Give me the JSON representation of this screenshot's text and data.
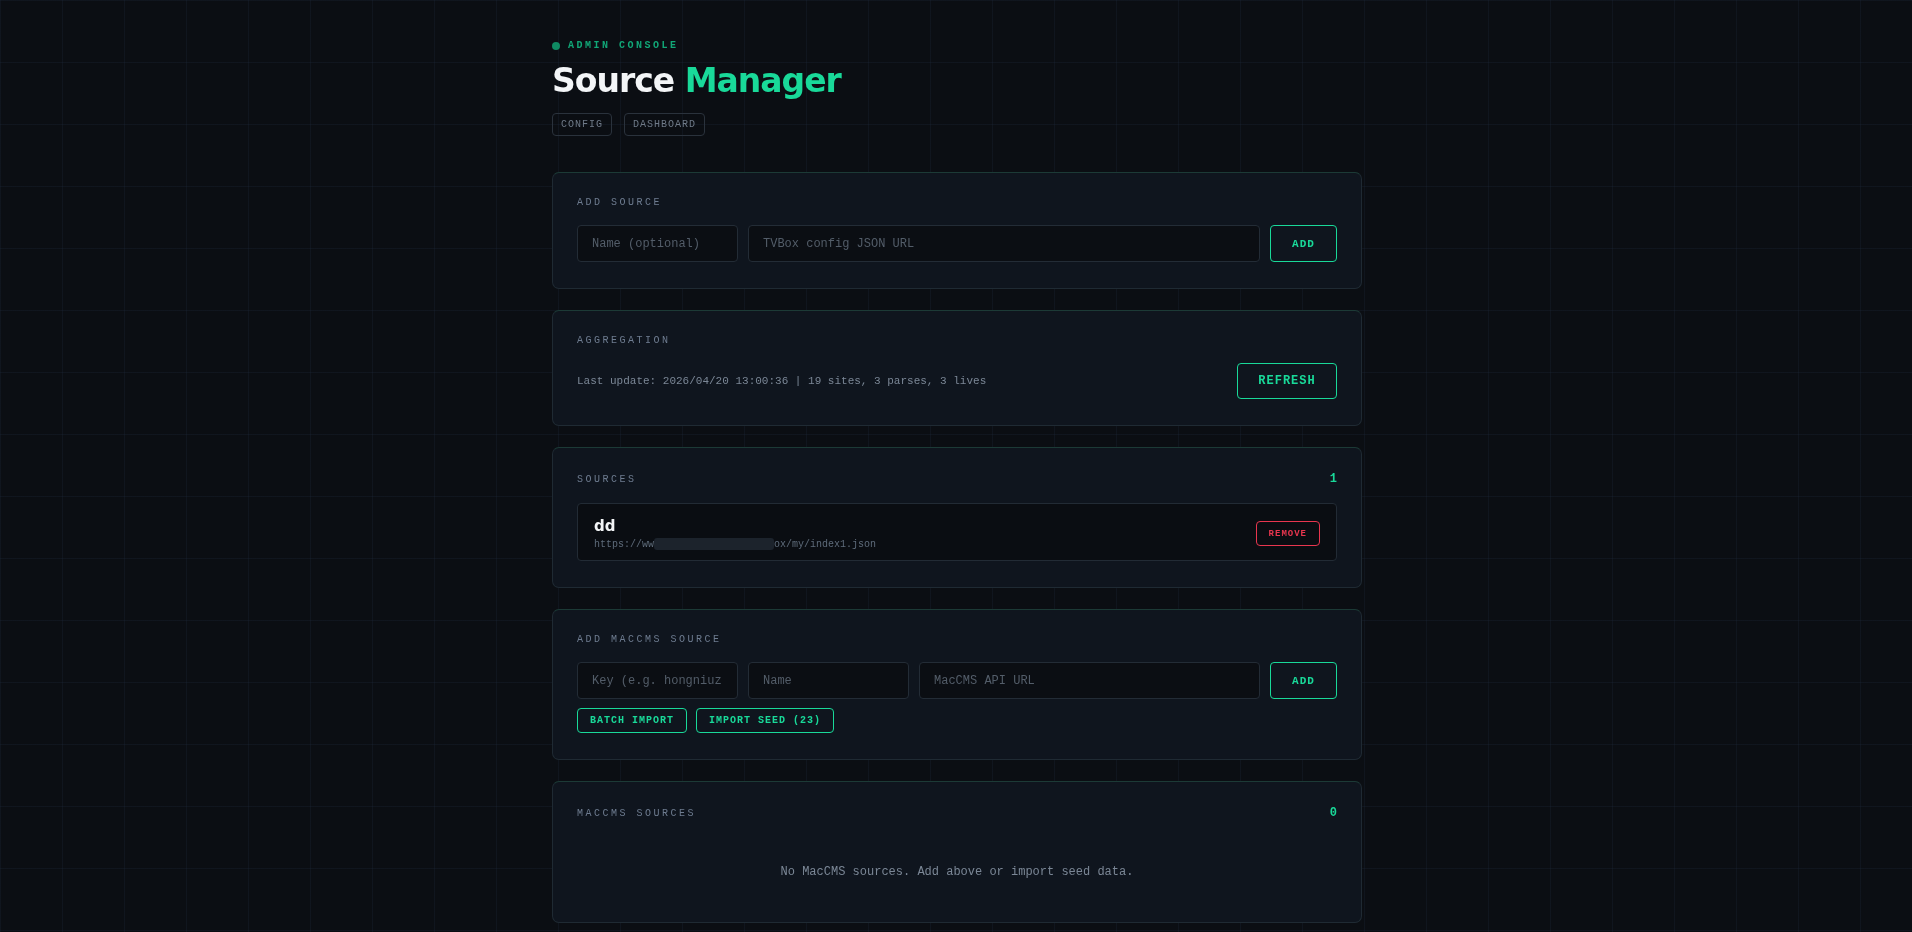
{
  "header": {
    "eyebrow": "ADMIN CONSOLE",
    "title_first": "Source",
    "title_accent": "Manager",
    "nav": [
      {
        "label": "CONFIG"
      },
      {
        "label": "DASHBOARD"
      }
    ]
  },
  "add_source": {
    "heading": "ADD SOURCE",
    "fields": [
      {
        "placeholder": "Name (optional)",
        "kind": "short"
      },
      {
        "placeholder": "TVBox config JSON URL",
        "kind": "wide"
      }
    ],
    "button": "ADD"
  },
  "aggregation": {
    "heading": "AGGREGATION",
    "status": "Last update: 2026/04/20 13:00:36 | 19 sites, 3 parses, 3 lives",
    "button": "REFRESH"
  },
  "sources": {
    "heading": "SOURCES",
    "count": "1",
    "items": [
      {
        "name": "dd",
        "url_start": "https://ww",
        "redacted": true,
        "url_end": "ox/my/index1.json",
        "button": "REMOVE"
      }
    ]
  },
  "add_maccms": {
    "heading": "ADD MACCMS SOURCE",
    "fields": [
      {
        "placeholder": "Key (e.g. hongniuz",
        "kind": "short"
      },
      {
        "placeholder": "Name",
        "kind": "short"
      },
      {
        "placeholder": "MacCMS API URL",
        "kind": "wide"
      }
    ],
    "button": "ADD",
    "actions": [
      "BATCH IMPORT",
      "IMPORT SEED (23)"
    ]
  },
  "maccms_sources": {
    "heading": "MACCMS SOURCES",
    "count": "0",
    "empty": "No MacCMS sources. Add above or import seed data."
  }
}
